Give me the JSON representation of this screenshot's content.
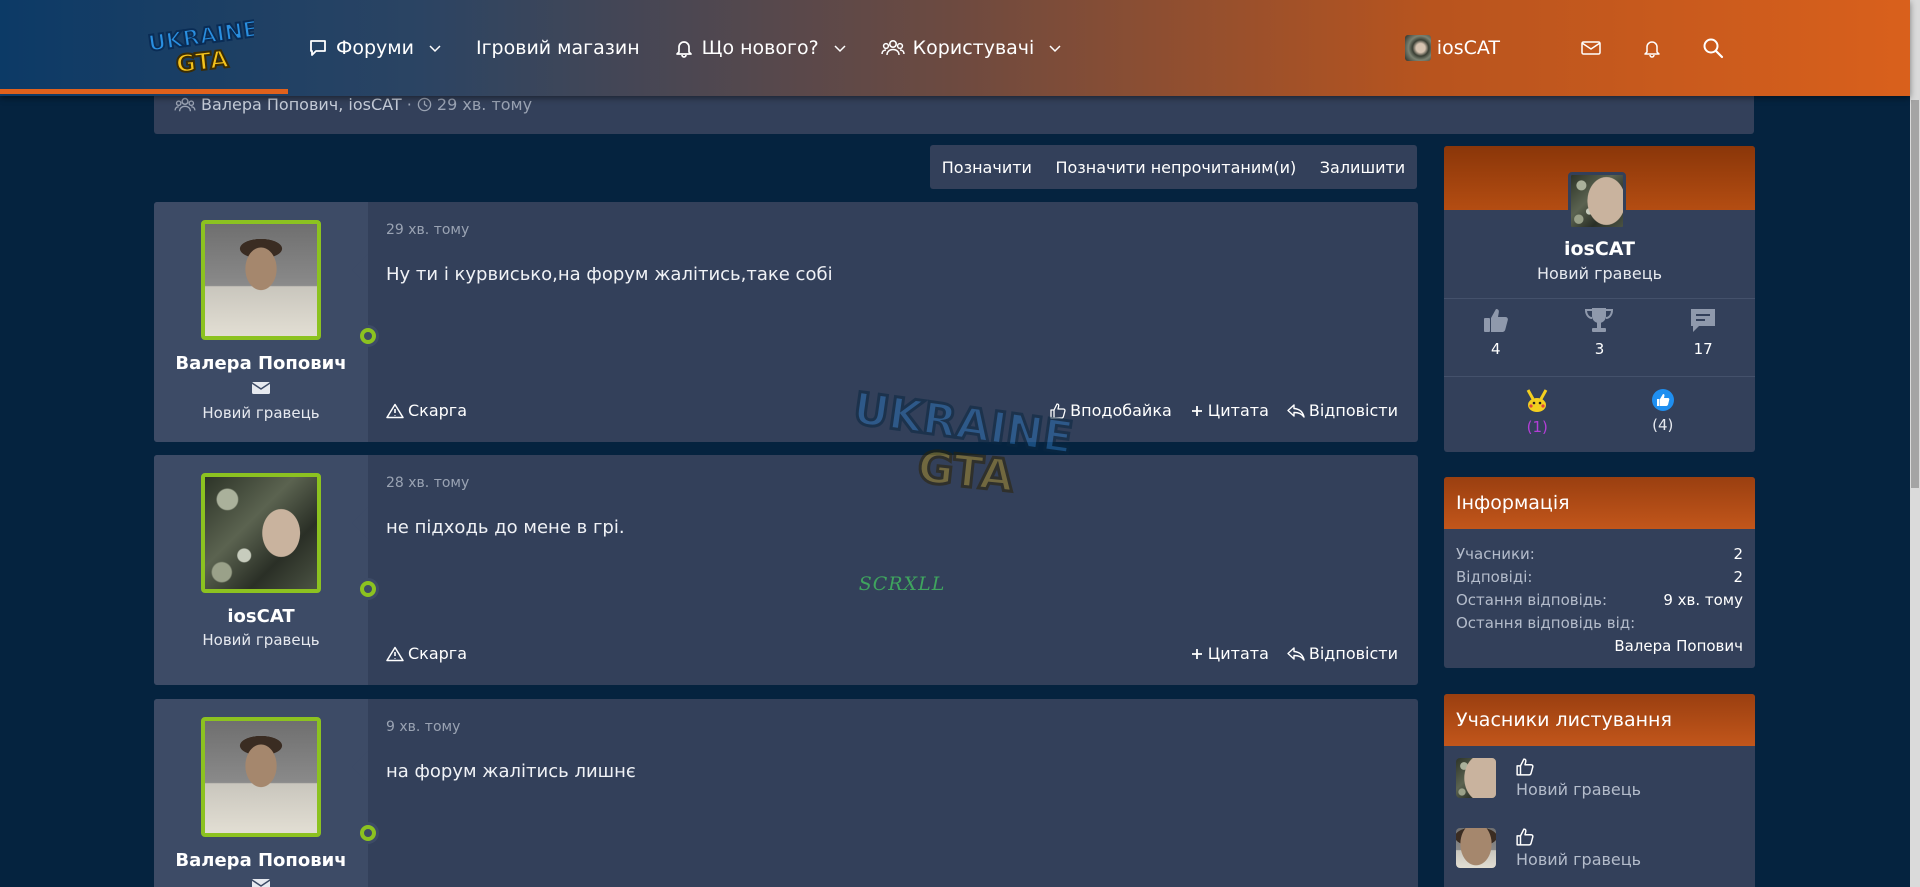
{
  "header": {
    "nav": [
      {
        "label": "Форуми",
        "icon": "chat-bubble-icon",
        "dropdown": true
      },
      {
        "label": "Ігровий магазин",
        "icon": "",
        "dropdown": false
      },
      {
        "label": "Що нового?",
        "icon": "bell-icon",
        "dropdown": true
      },
      {
        "label": "Користувачі",
        "icon": "users-icon",
        "dropdown": true
      }
    ],
    "user": "iosCAT",
    "accent": "#d9601c"
  },
  "topbox": {
    "participants": "Валера Попович",
    "participants_2": "iosCAT",
    "separator": "·",
    "time": "29 хв. тому"
  },
  "actions": {
    "mark": "Позначити",
    "mark_unread": "Позначити непрочитаним(и)",
    "leave": "Залишити"
  },
  "posts": [
    {
      "author": "Валера Попович",
      "rank": "Новий гравець",
      "time": "29 хв. тому",
      "text": "Ну ти і курвисько,на форум жалітись,таке собі",
      "report": "Скарга",
      "like": "Вподобайка",
      "quote": "Цитата",
      "reply": "Відповісти"
    },
    {
      "author": "iosCAT",
      "rank": "Новий гравець",
      "time": "28 хв. тому",
      "text": "не підходь до мене в грі.",
      "signature": "SCRXLL",
      "report": "Скарга",
      "quote": "Цитата",
      "reply": "Відповісти"
    },
    {
      "author": "Валера Попович",
      "rank": "Новий гравець",
      "time": "9 хв. тому",
      "text": "на форум жалітись лишнє"
    }
  ],
  "profile": {
    "name": "iosCAT",
    "rank": "Новий гравець",
    "stats": [
      {
        "icon": "thumbs-up-icon",
        "value": "4"
      },
      {
        "icon": "trophy-icon",
        "value": "3"
      },
      {
        "icon": "message-icon",
        "value": "17"
      }
    ],
    "reactions": [
      {
        "icon": "pikachu-icon",
        "value": "(1)",
        "color": "#b23ed6"
      },
      {
        "icon": "like-badge-icon",
        "value": "(4)",
        "color": "#ffffff"
      }
    ]
  },
  "info": {
    "title": "Інформація",
    "participants_label": "Учасники:",
    "participants_value": "2",
    "replies_label": "Відповіді:",
    "replies_value": "2",
    "last_reply_label": "Остання відповідь:",
    "last_reply_value": "9 хв. тому",
    "last_reply_by_label": "Остання відповідь від:",
    "last_reply_by_value": "Валера Попович"
  },
  "participants": {
    "title": "Учасники листування",
    "items": [
      {
        "rank": "Новий гравець"
      },
      {
        "rank": "Новий гравець"
      }
    ]
  }
}
